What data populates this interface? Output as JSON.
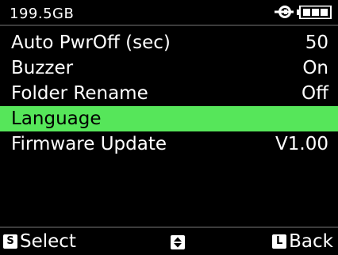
{
  "status_bar": {
    "storage": "199.5GB",
    "connector_icon": "plug-connector-icon",
    "battery_icon": "battery-full-icon"
  },
  "menu": {
    "items": [
      {
        "label": "Auto PwrOff (sec)",
        "value": "50"
      },
      {
        "label": "Buzzer",
        "value": "On"
      },
      {
        "label": "Folder Rename",
        "value": "Off"
      },
      {
        "label": "Language",
        "value": ""
      },
      {
        "label": "Firmware Update",
        "value": "V1.00"
      }
    ],
    "selected_index": 3
  },
  "softkeys": {
    "left_key_glyph": "S",
    "left_label": "Select",
    "center_icon": "up-down-arrows-icon",
    "right_key_glyph": "L",
    "right_label": "Back"
  },
  "colors": {
    "background": "#000000",
    "text": "#ffffff",
    "selection": "#56e65a"
  }
}
